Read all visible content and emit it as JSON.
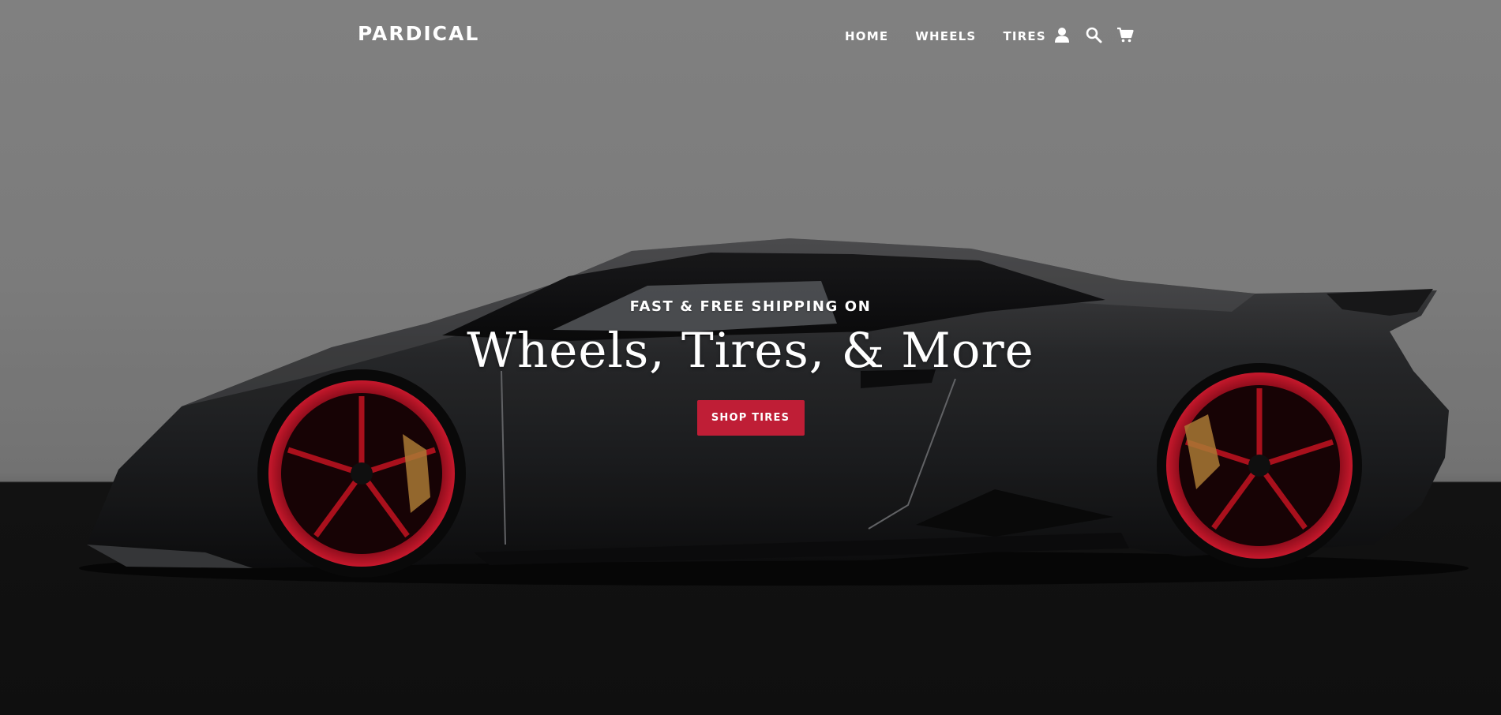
{
  "brand": {
    "name": "PARDICAL"
  },
  "nav": {
    "items": [
      {
        "label": "HOME"
      },
      {
        "label": "WHEELS"
      },
      {
        "label": "TIRES"
      }
    ],
    "icons": [
      "account-icon",
      "search-icon",
      "cart-icon"
    ]
  },
  "hero": {
    "eyebrow": "FAST & FREE SHIPPING ON",
    "headline": "Wheels, Tires, & More",
    "cta_label": "SHOP TIRES",
    "image_subject": "sports-car-red-wheels"
  },
  "colors": {
    "accent": "#bf1e36",
    "text": "#ffffff",
    "wheel": "#c40f24"
  }
}
